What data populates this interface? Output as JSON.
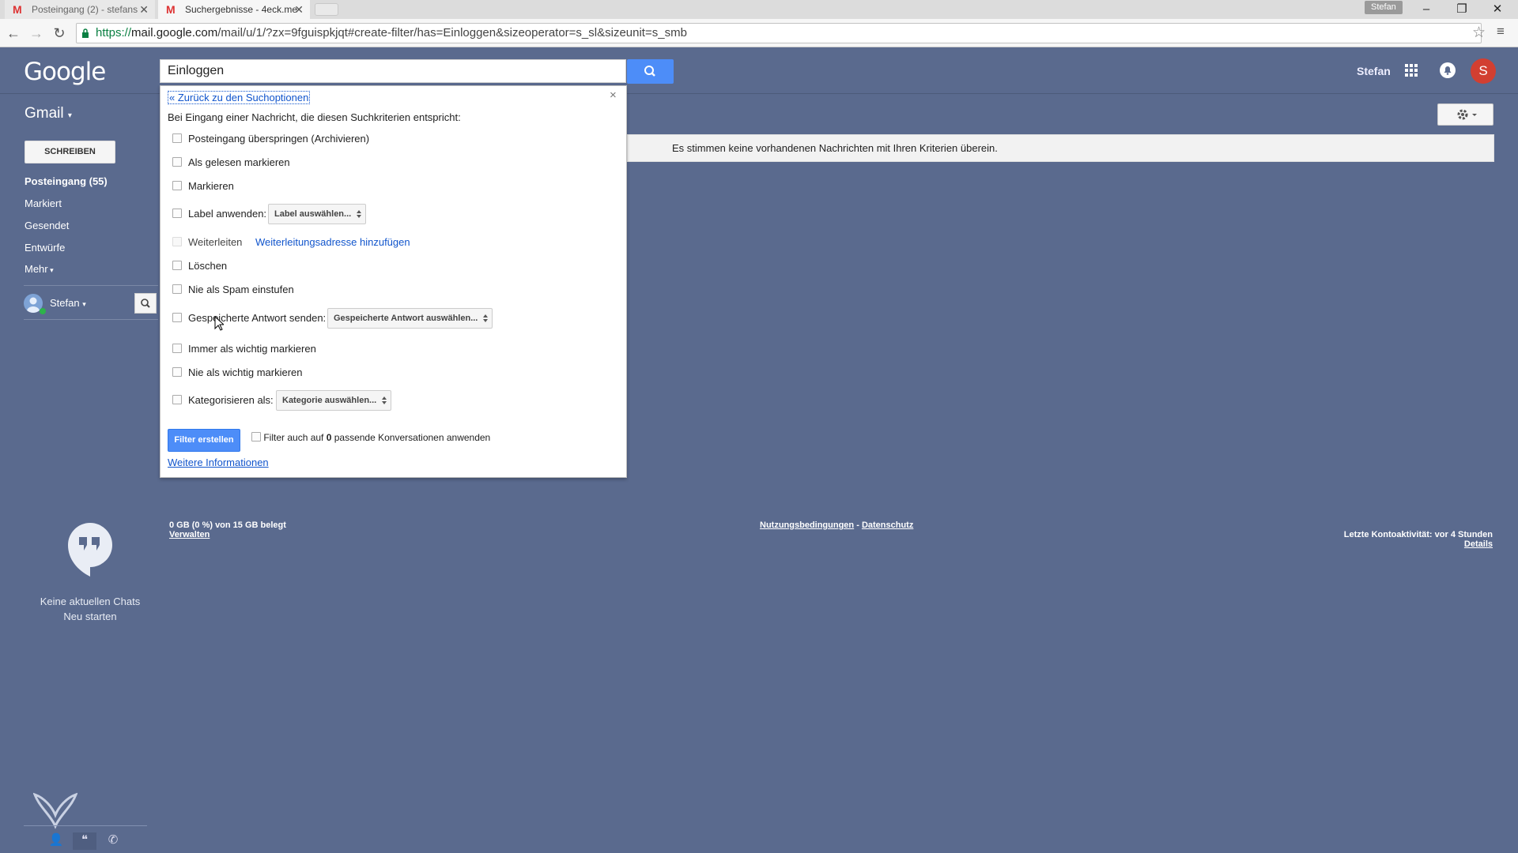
{
  "browser": {
    "tabs": [
      {
        "title": "Posteingang (2) - stefans",
        "active": false
      },
      {
        "title": "Suchergebnisse - 4eck.me",
        "active": true
      }
    ],
    "profile_name": "Stefan",
    "url_scheme": "https://",
    "url_host": "mail.google.com",
    "url_rest": "/mail/u/1/?zx=9fguispkjqt#create-filter/has=Einloggen&sizeoperator=s_sl&sizeunit=s_smb"
  },
  "header": {
    "logo_text": "Google",
    "search_query": "Einloggen",
    "user_name": "Stefan",
    "avatar_letter": "S"
  },
  "sidebar": {
    "product_label": "Gmail",
    "compose_label": "SCHREIBEN",
    "items": [
      {
        "label": "Posteingang (55)",
        "bold": true
      },
      {
        "label": "Markiert",
        "bold": false
      },
      {
        "label": "Gesendet",
        "bold": false
      },
      {
        "label": "Entwürfe",
        "bold": false
      },
      {
        "label": "Mehr",
        "bold": false
      }
    ],
    "chat_user": "Stefan",
    "chat_empty_text": "Keine aktuellen Chats",
    "chat_new_link": "Neu starten"
  },
  "info_message": "Es stimmen keine vorhandenen Nachrichten mit Ihren Kriterien überein.",
  "filter_dialog": {
    "back_link": "« Zurück zu den Suchoptionen",
    "close_symbol": "×",
    "intro": "Bei Eingang einer Nachricht, die diesen Suchkriterien entspricht:",
    "options": [
      {
        "label": "Posteingang überspringen (Archivieren)"
      },
      {
        "label": "Als gelesen markieren"
      },
      {
        "label": "Markieren"
      },
      {
        "label": "Label anwenden:",
        "select": "Label auswählen..."
      },
      {
        "label": "Weiterleiten",
        "link": "Weiterleitungsadresse hinzufügen",
        "disabled": true
      },
      {
        "label": "Löschen"
      },
      {
        "label": "Nie als Spam einstufen"
      },
      {
        "label": "Gespeicherte Antwort senden:",
        "select": "Gespeicherte Antwort auswählen..."
      },
      {
        "label": "Immer als wichtig markieren"
      },
      {
        "label": "Nie als wichtig markieren"
      },
      {
        "label": "Kategorisieren als:",
        "select": "Kategorie auswählen..."
      }
    ],
    "create_button": "Filter erstellen",
    "apply_also_prefix": "Filter auch auf ",
    "apply_also_count": "0",
    "apply_also_suffix": " passende Konversationen anwenden",
    "more_info_link": "Weitere Informationen"
  },
  "footer": {
    "storage": "0 GB (0 %) von 15 GB belegt",
    "manage": "Verwalten",
    "terms": "Nutzungsbedingungen",
    "separator": " - ",
    "privacy": "Datenschutz",
    "last_activity": "Letzte Kontoaktivität: vor 4 Stunden",
    "details": "Details"
  },
  "colors": {
    "background": "#5a6a8e",
    "primary_button": "#4d8df8",
    "avatar": "#d23f31",
    "link": "#1155cc"
  }
}
